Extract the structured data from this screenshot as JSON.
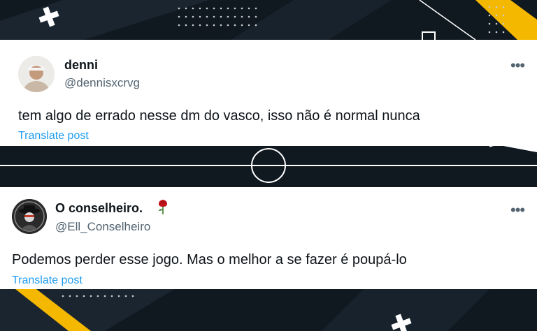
{
  "colors": {
    "background": "#101820",
    "accent_yellow": "#f5b800",
    "link": "#1d9bf0",
    "text": "#0f1419",
    "secondary": "#536471"
  },
  "posts": [
    {
      "display_name": "denni",
      "handle": "@dennisxcrvg",
      "text": "tem algo de errado nesse dm do vasco, isso não é normal nunca",
      "translate_label": "Translate post",
      "more_label": "•••"
    },
    {
      "display_name": "O conselheiro.",
      "name_emoji": "rose-icon",
      "handle": "@Ell_Conselheiro",
      "text": "Podemos perder esse jogo. Mas o melhor a se fazer é poupá-lo",
      "translate_label": "Translate post",
      "more_label": "•••"
    }
  ]
}
